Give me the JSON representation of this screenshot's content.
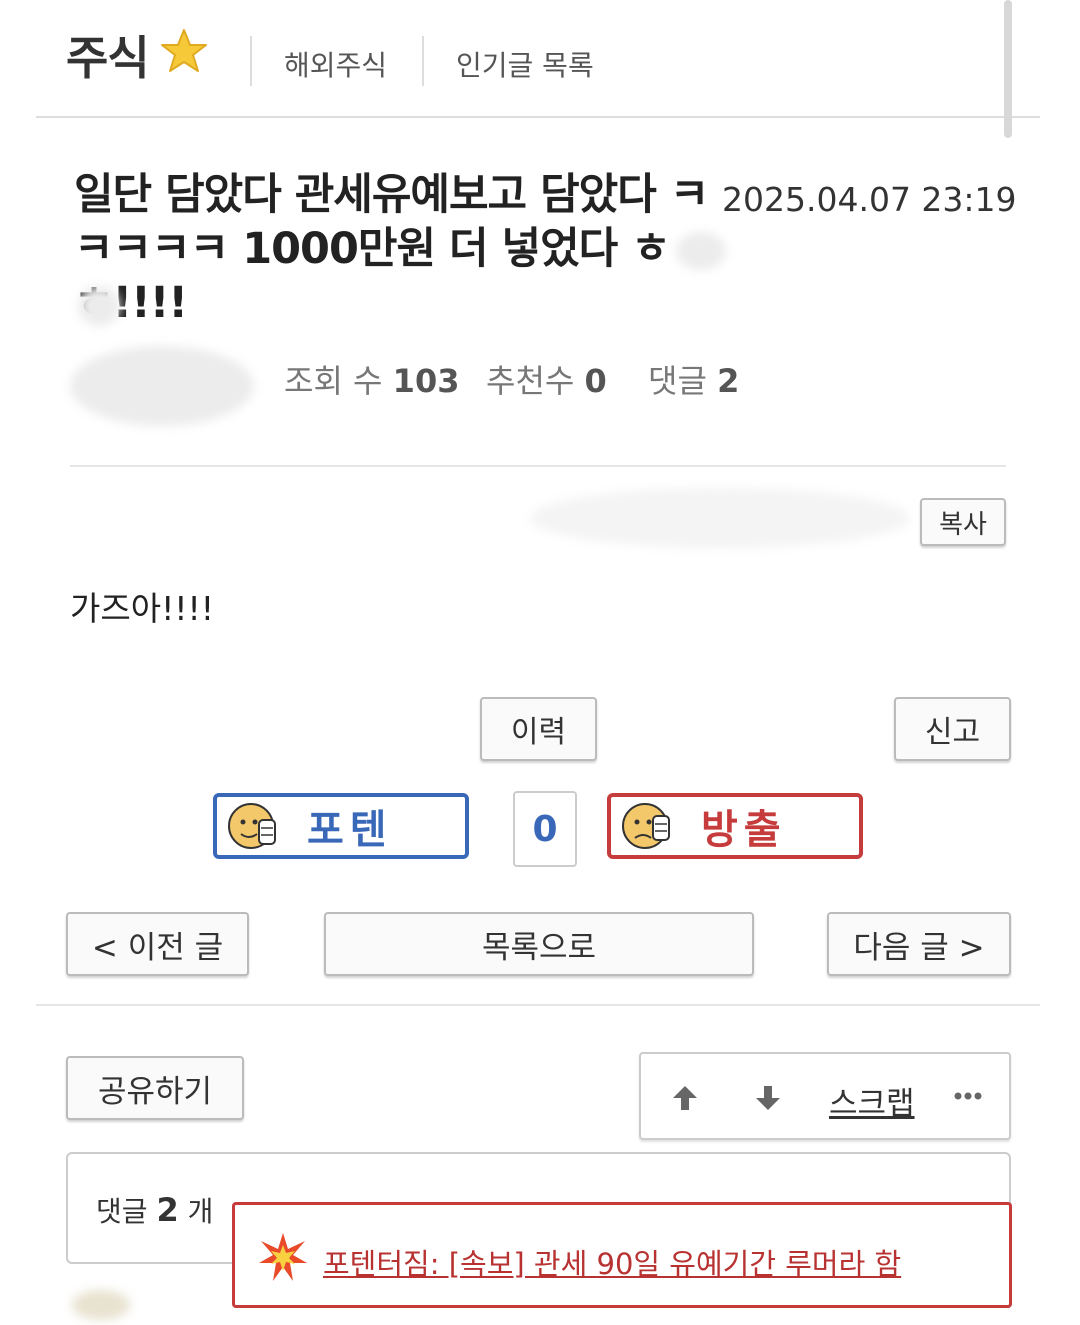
{
  "header": {
    "gallery_title": "주식",
    "links": [
      "해외주식",
      "인기글 목록"
    ]
  },
  "post": {
    "title": "일단 담았다 관세유예보고 담았다 ㅋㅋㅋㅋㅋ 1000만원 더 넣었다 ㅎㅎ!!!!",
    "date": "2025.04.07 23:19",
    "views_label": "조회 수",
    "views": "103",
    "recommend_label": "추천수",
    "recommend": "0",
    "comments_label": "댓글",
    "comments": "2",
    "copy_button": "복사",
    "content": "가즈아!!!!",
    "history_button": "이력",
    "report_button": "신고"
  },
  "vote": {
    "up_label": "포텐",
    "count": "0",
    "down_label": "방출",
    "up_color": "#3a68b8",
    "down_color": "#c63c3c"
  },
  "nav": {
    "prev": "< 이전 글",
    "list": "목록으로",
    "next": "다음 글 >"
  },
  "actions": {
    "share": "공유하기",
    "scrap": "스크랩",
    "up_icon": "arrow-up-icon",
    "down_icon": "arrow-down-icon",
    "more_icon": "more-dots-icon"
  },
  "comments_section": {
    "label_prefix": "댓글",
    "count": "2",
    "label_suffix": "개"
  },
  "toast": {
    "text": "포텐터짐: [속보] 관세 90일 유예기간 루머라 함"
  }
}
